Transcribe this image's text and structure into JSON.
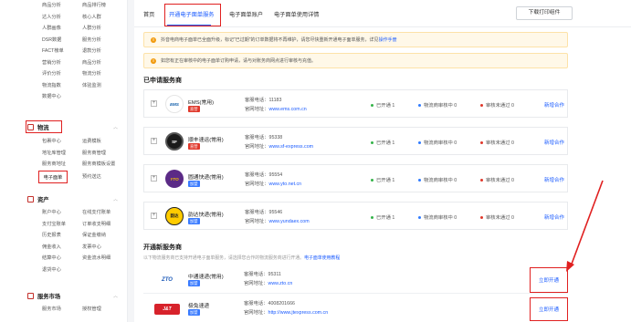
{
  "sidebar": {
    "top_grid": [
      [
        "商品分析",
        "商品排行榜"
      ],
      [
        "达人分析",
        "核心人群"
      ],
      [
        "人群画像",
        "人群分析"
      ],
      [
        "DSR数据",
        "服务分析"
      ],
      [
        "FACT榜单",
        "退款分析"
      ],
      [
        "营销分析",
        "商品分析"
      ],
      [
        "评价分析",
        "物流分析"
      ],
      [
        "物流指数",
        "体验监测"
      ],
      [
        "数据中心",
        ""
      ]
    ],
    "logistics": {
      "label": "物流",
      "items": [
        [
          "包裹中心",
          "运费模板"
        ],
        [
          "地址库管理",
          "服务商管理"
        ],
        [
          "服务商地址",
          "服务商模板设置"
        ]
      ],
      "active_item": "电子面单",
      "next_item": "预约送达"
    },
    "assets": {
      "label": "资产",
      "items": [
        [
          "账户中心",
          "在线支付账单"
        ],
        [
          "支付宝账单",
          "订单收支明细"
        ],
        [
          "历史报表",
          "保证金缴纳"
        ],
        [
          "佣金收入",
          "发票中心"
        ],
        [
          "结算中心",
          "资金流水明细"
        ],
        [
          "退货中心",
          ""
        ]
      ]
    },
    "service_market": {
      "label": "服务市场",
      "items": [
        [
          "服务市场",
          "授权管理"
        ]
      ]
    }
  },
  "tabs": [
    "首页",
    "开通电子面单服务",
    "电子面单账户",
    "电子面单使用详情"
  ],
  "print_button": "下载打印组件",
  "notice1": {
    "text": "抖音电商电子面单已全面升级，标记\"已过期\"的订单数据将不再维护，请您尽快重新开通电子面单服务，详见",
    "link": "操作手册"
  },
  "notice2": {
    "text": "如您有正在审核中的电子面单订购申请，请与对账务商网点进行审核与充值。"
  },
  "applied_title": "已申请服务商",
  "applied": [
    {
      "name": "EMS(常用)",
      "badge": "直营",
      "logo": "EMS",
      "phone_label": "客服电话：",
      "phone": "11183",
      "site_label": "官网地址：",
      "site": "www.ems.com.cn",
      "opened": "已开通 1",
      "reviewing": "物流商审核中 0",
      "rejected": "审核未通过 0",
      "action": "新增合作"
    },
    {
      "name": "顺丰速运(常用)",
      "badge": "直营",
      "logo": "SF",
      "phone_label": "客服电话：",
      "phone": "95338",
      "site_label": "官网地址：",
      "site": "www.sf-express.com",
      "opened": "已开通 1",
      "reviewing": "物流商审核中 0",
      "rejected": "审核未通过 0",
      "action": "新增合作"
    },
    {
      "name": "圆通快递(常用)",
      "badge": "加盟",
      "logo": "YTO",
      "phone_label": "客服电话：",
      "phone": "95554",
      "site_label": "官网地址：",
      "site": "www.yto.net.cn",
      "opened": "已开通 1",
      "reviewing": "物流商审核中 0",
      "rejected": "审核未通过 0",
      "action": "新增合作"
    },
    {
      "name": "韵达快递(常用)",
      "badge": "加盟",
      "logo": "韵达",
      "phone_label": "客服电话：",
      "phone": "95546",
      "site_label": "官网地址：",
      "site": "www.yundaex.com",
      "opened": "已开通 1",
      "reviewing": "物流商审核中 0",
      "rejected": "审核未通过 0",
      "action": "新增合作"
    }
  ],
  "new_title": "开通新服务商",
  "new_sub": {
    "text": "以下物流服务商已支持开通电子面单服务，请选择您合作的物流服务商进行开通。",
    "link": "电子面单使用教程"
  },
  "new_providers": [
    {
      "name": "中通速递(常用)",
      "badge": "加盟",
      "logo": "ZTO",
      "phone_label": "客服电话：",
      "phone": "95311",
      "site_label": "官网地址：",
      "site": "www.zto.cn",
      "action": "立即开通"
    },
    {
      "name": "极兔速递",
      "badge": "加盟",
      "logo": "J&T",
      "phone_label": "客服电话：",
      "phone": "4008201666",
      "site_label": "官网地址：",
      "site": "http://www.jtexpress.com.cn",
      "action": "立即开通"
    }
  ],
  "colors": {
    "accent": "#1a5bff",
    "highlight": "#e02020",
    "opened": "#35b34a",
    "reviewing": "#2f7bff",
    "rejected": "#e0382b"
  }
}
